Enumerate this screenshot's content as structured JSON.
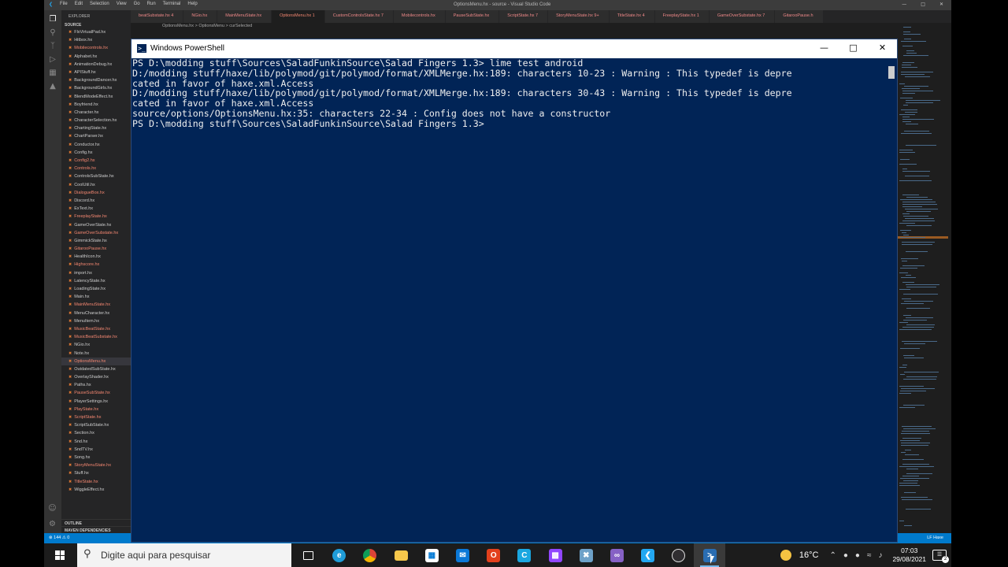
{
  "vscode": {
    "menu": [
      "File",
      "Edit",
      "Selection",
      "View",
      "Go",
      "Run",
      "Terminal",
      "Help"
    ],
    "window_title": "OptionsMenu.hx - source - Visual Studio Code",
    "explorer_header": "EXPLORER",
    "source_section": "SOURCE",
    "outline_section": "OUTLINE",
    "mavendeps_section": "MAVEN DEPENDENCIES",
    "files": [
      {
        "name": "FlxVirtualPad.hx",
        "error": false
      },
      {
        "name": "Hitbox.hx",
        "error": false
      },
      {
        "name": "Mobilecontrols.hx",
        "error": true
      },
      {
        "name": "Alphabet.hx",
        "error": false
      },
      {
        "name": "AnimationDebug.hx",
        "error": false
      },
      {
        "name": "APIStuff.hx",
        "error": false
      },
      {
        "name": "BackgroundDancer.hx",
        "error": false
      },
      {
        "name": "BackgroundGirls.hx",
        "error": false
      },
      {
        "name": "BlendModeEffect.hx",
        "error": false
      },
      {
        "name": "Boyfriend.hx",
        "error": false
      },
      {
        "name": "Character.hx",
        "error": false
      },
      {
        "name": "CharacterSelection.hx",
        "error": false
      },
      {
        "name": "ChartingState.hx",
        "error": false
      },
      {
        "name": "ChartParser.hx",
        "error": false
      },
      {
        "name": "Conductor.hx",
        "error": false
      },
      {
        "name": "Config.hx",
        "error": false
      },
      {
        "name": "Config2.hx",
        "error": true
      },
      {
        "name": "Controls.hx",
        "error": true
      },
      {
        "name": "ControlsSubState.hx",
        "error": false
      },
      {
        "name": "CoolUtil.hx",
        "error": false
      },
      {
        "name": "DialogueBox.hx",
        "error": true
      },
      {
        "name": "Discord.hx",
        "error": false
      },
      {
        "name": "ExText.hx",
        "error": false
      },
      {
        "name": "FreeplayState.hx",
        "error": true
      },
      {
        "name": "GameOverState.hx",
        "error": false
      },
      {
        "name": "GameOverSubstate.hx",
        "error": true
      },
      {
        "name": "GimmickState.hx",
        "error": false
      },
      {
        "name": "GitarooPause.hx",
        "error": true
      },
      {
        "name": "HealthIcon.hx",
        "error": false
      },
      {
        "name": "Highscore.hx",
        "error": true
      },
      {
        "name": "import.hx",
        "error": false
      },
      {
        "name": "LatencyState.hx",
        "error": false
      },
      {
        "name": "LoadingState.hx",
        "error": false
      },
      {
        "name": "Main.hx",
        "error": false
      },
      {
        "name": "MainMenuState.hx",
        "error": true
      },
      {
        "name": "MenuCharacter.hx",
        "error": false
      },
      {
        "name": "MenuItem.hx",
        "error": false
      },
      {
        "name": "MusicBeatState.hx",
        "error": true
      },
      {
        "name": "MusicBeatSubstate.hx",
        "error": true
      },
      {
        "name": "NGio.hx",
        "error": false
      },
      {
        "name": "Note.hx",
        "error": false
      },
      {
        "name": "OptionsMenu.hx",
        "error": true,
        "selected": true
      },
      {
        "name": "OutdatedSubState.hx",
        "error": false
      },
      {
        "name": "OverlayShader.hx",
        "error": false
      },
      {
        "name": "Paths.hx",
        "error": false
      },
      {
        "name": "PauseSubState.hx",
        "error": true
      },
      {
        "name": "PlayerSettings.hx",
        "error": false
      },
      {
        "name": "PlayState.hx",
        "error": true
      },
      {
        "name": "ScriptState.hx",
        "error": true
      },
      {
        "name": "ScriptSubState.hx",
        "error": false
      },
      {
        "name": "Section.hx",
        "error": false
      },
      {
        "name": "Snd.hx",
        "error": false
      },
      {
        "name": "SndTV.hx",
        "error": false
      },
      {
        "name": "Song.hx",
        "error": false
      },
      {
        "name": "StoryMenuState.hx",
        "error": true
      },
      {
        "name": "Stuff.hx",
        "error": false
      },
      {
        "name": "TitleState.hx",
        "error": true
      },
      {
        "name": "WiggleEffect.hx",
        "error": false
      }
    ],
    "tabs": [
      {
        "label": "beatSubstate.hx 4",
        "active": false
      },
      {
        "label": "NGio.hx",
        "active": false
      },
      {
        "label": "MainMenuState.hx",
        "active": false
      },
      {
        "label": "OptionsMenu.hx 1",
        "active": true
      },
      {
        "label": "CustomControlsState.hx 7",
        "active": false
      },
      {
        "label": "Mobilecontrols.hx",
        "active": false
      },
      {
        "label": "PauseSubState.hx",
        "active": false
      },
      {
        "label": "ScriptState.hx 7",
        "active": false
      },
      {
        "label": "StoryMenuState.hx 9+",
        "active": false
      },
      {
        "label": "TitleState.hx 4",
        "active": false
      },
      {
        "label": "FreeplayState.hx 1",
        "active": false
      },
      {
        "label": "GameOverSubstate.hx 7",
        "active": false
      },
      {
        "label": "GitarooPause.h",
        "active": false
      }
    ],
    "breadcrumb": "OptionsMenu.hx  >  OptionsMenu  >  curSelected",
    "status_left": "⊗ 144 ⚠ 0",
    "status_right": "LF   Haxe"
  },
  "powershell": {
    "title": "Windows PowerShell",
    "lines": [
      "PS D:\\modding stuff\\Sources\\SaladFunkinSource\\Salad Fingers 1.3> lime test android",
      "D:/modding stuff/haxe/lib/polymod/git/polymod/format/XMLMerge.hx:189: characters 10-23 : Warning : This typedef is depre",
      "cated in favor of haxe.xml.Access",
      "D:/modding stuff/haxe/lib/polymod/git/polymod/format/XMLMerge.hx:189: characters 30-43 : Warning : This typedef is depre",
      "cated in favor of haxe.xml.Access",
      "source/options/OptionsMenu.hx:35: characters 22-34 : Config does not have a constructor",
      "PS D:\\modding stuff\\Sources\\SaladFunkinSource\\Salad Fingers 1.3>"
    ]
  },
  "taskbar": {
    "search_placeholder": "Digite aqui para pesquisar",
    "temperature": "16°C",
    "time": "07:03",
    "date": "29/08/2021",
    "notifications": "2"
  }
}
